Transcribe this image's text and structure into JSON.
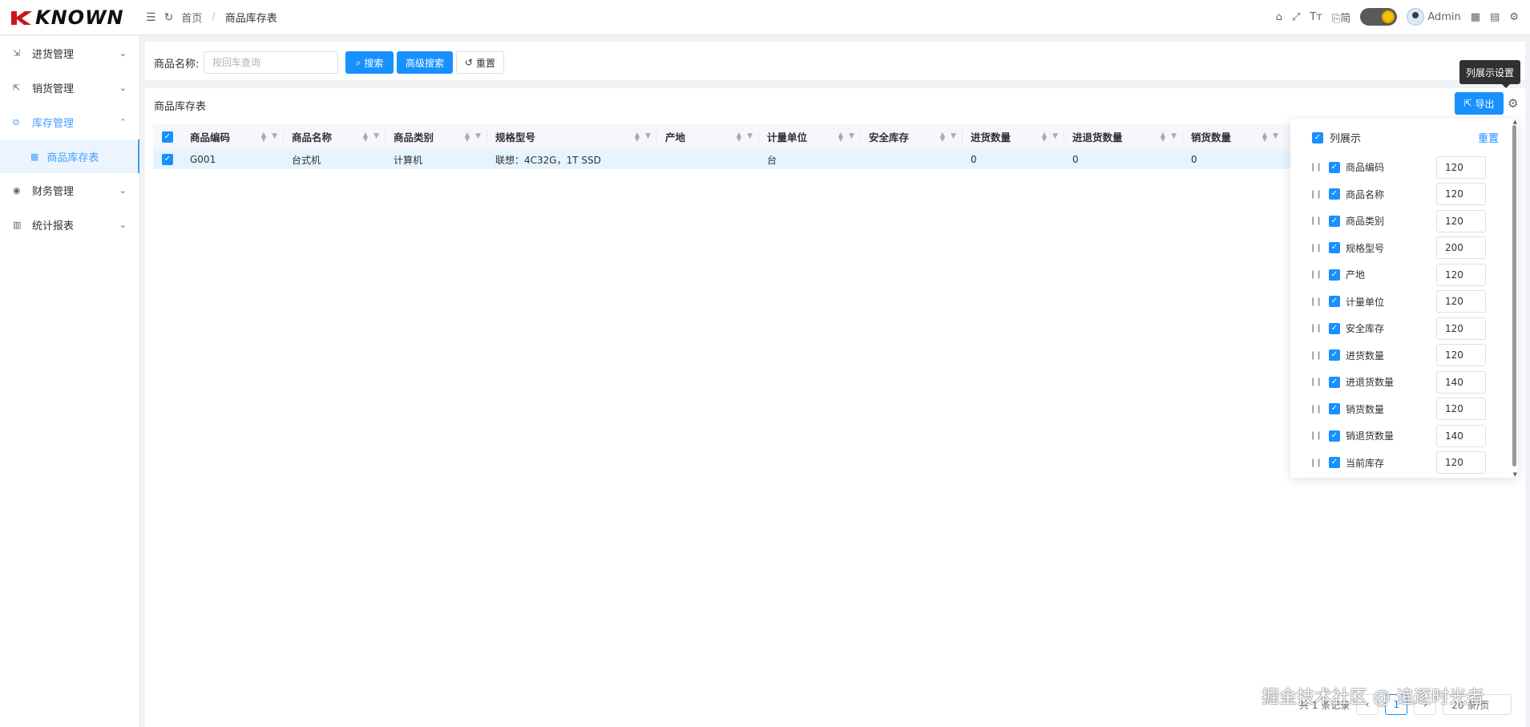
{
  "header": {
    "logo_text": "KNOWN",
    "breadcrumb": {
      "home": "首页",
      "separator": "/",
      "current": "商品库存表"
    },
    "lang_label": "简",
    "user_name": "Admin"
  },
  "sidebar": {
    "items": [
      {
        "label": "进货管理",
        "icon": "import-icon",
        "expanded": false
      },
      {
        "label": "销货管理",
        "icon": "export-icon",
        "expanded": false
      },
      {
        "label": "库存管理",
        "icon": "inventory-icon",
        "expanded": true
      },
      {
        "label": "财务管理",
        "icon": "finance-icon",
        "expanded": false
      },
      {
        "label": "统计报表",
        "icon": "chart-icon",
        "expanded": false
      }
    ],
    "sub_item": {
      "label": "商品库存表",
      "icon": "table-icon"
    }
  },
  "search": {
    "label": "商品名称:",
    "placeholder": "按回车查询",
    "value": "",
    "search_btn": "搜索",
    "advanced_btn": "高级搜索",
    "reset_btn": "重置"
  },
  "table": {
    "title": "商品库存表",
    "export_btn": "导出",
    "columns": [
      "商品编码",
      "商品名称",
      "商品类别",
      "规格型号",
      "产地",
      "计量单位",
      "安全库存",
      "进货数量",
      "进退货数量",
      "销货数量"
    ],
    "rows": [
      [
        "G001",
        "台式机",
        "计算机",
        "联想：4C32G，1T SSD",
        "",
        "台",
        "",
        "0",
        "0",
        "0"
      ]
    ]
  },
  "pagination": {
    "total_text": "共 1 条记录",
    "current_page": "1",
    "page_size": "20 条/页"
  },
  "tooltip": "列展示设置",
  "column_panel": {
    "title": "列展示",
    "reset": "重置",
    "columns": [
      {
        "label": "商品编码",
        "width": "120"
      },
      {
        "label": "商品名称",
        "width": "120"
      },
      {
        "label": "商品类别",
        "width": "120"
      },
      {
        "label": "规格型号",
        "width": "200"
      },
      {
        "label": "产地",
        "width": "120"
      },
      {
        "label": "计量单位",
        "width": "120"
      },
      {
        "label": "安全库存",
        "width": "120"
      },
      {
        "label": "进货数量",
        "width": "120"
      },
      {
        "label": "进退货数量",
        "width": "140"
      },
      {
        "label": "销货数量",
        "width": "120"
      },
      {
        "label": "销退货数量",
        "width": "140"
      },
      {
        "label": "当前库存",
        "width": "120"
      }
    ]
  },
  "watermark": "掘金技术社区 @ 追逐时光者",
  "colors": {
    "primary": "#1890ff",
    "selected_row": "#e6f4ff"
  }
}
